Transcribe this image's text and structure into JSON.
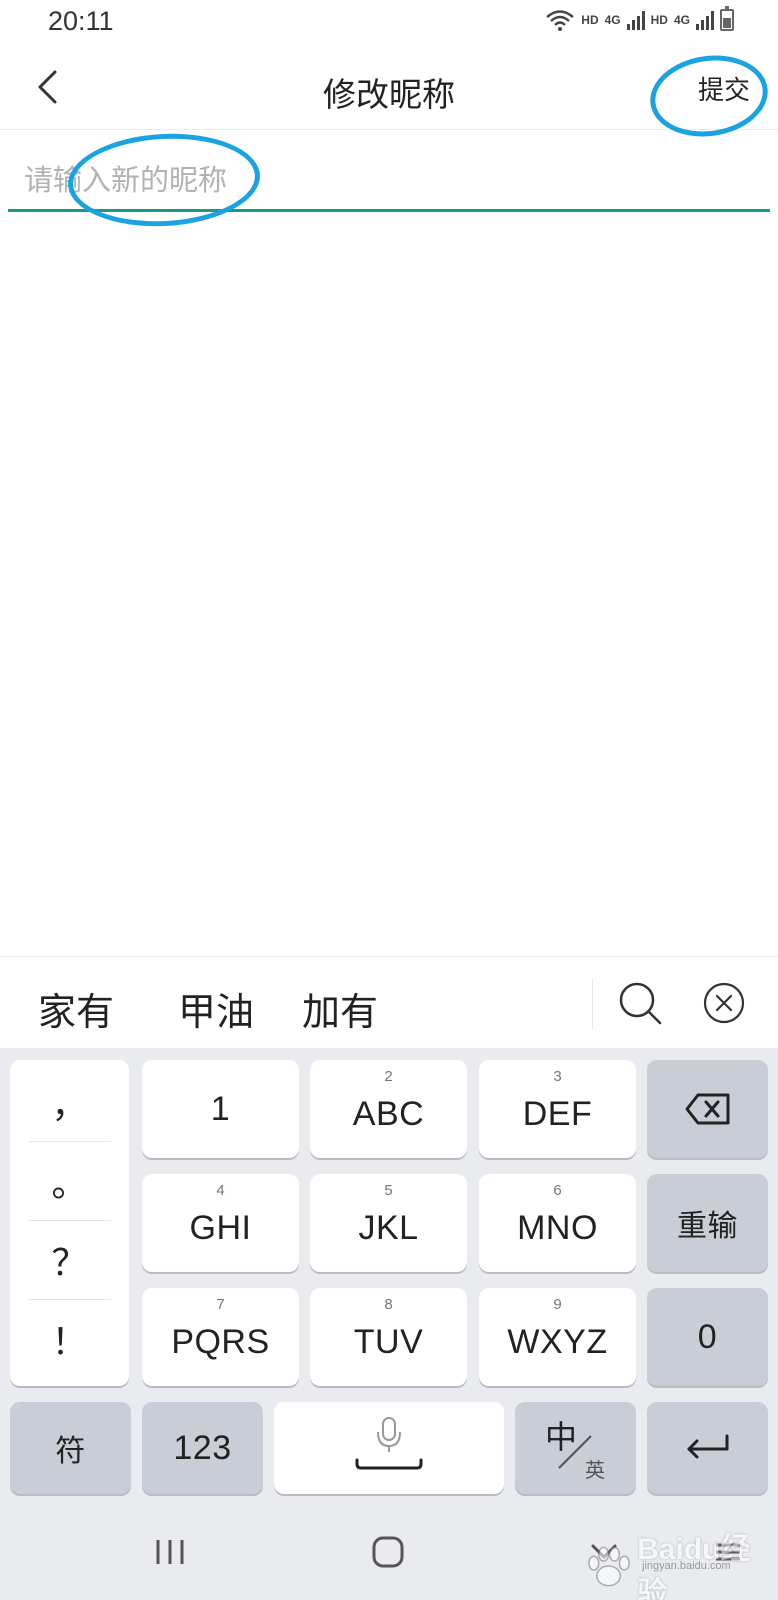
{
  "status_bar": {
    "time": "20:11",
    "hd1": "HD",
    "net1": "4G",
    "hd2": "HD",
    "net2": "4G"
  },
  "nav": {
    "title": "修改昵称",
    "submit_label": "提交"
  },
  "nickname_input": {
    "value": "",
    "placeholder": "请输入新的昵称"
  },
  "candidates": [
    "家有",
    "甲油",
    "加有"
  ],
  "keyboard": {
    "punctuation": [
      "，",
      "。",
      "？",
      "！"
    ],
    "rows": [
      [
        {
          "num": "",
          "label": "1"
        },
        {
          "num": "2",
          "label": "ABC"
        },
        {
          "num": "3",
          "label": "DEF"
        }
      ],
      [
        {
          "num": "4",
          "label": "GHI"
        },
        {
          "num": "5",
          "label": "JKL"
        },
        {
          "num": "6",
          "label": "MNO"
        }
      ],
      [
        {
          "num": "7",
          "label": "PQRS"
        },
        {
          "num": "8",
          "label": "TUV"
        },
        {
          "num": "9",
          "label": "WXYZ"
        }
      ]
    ],
    "reset_label": "重输",
    "zero_label": "0",
    "symbol_label": "符",
    "num_label": "123",
    "lang_primary": "中",
    "lang_secondary": "英"
  },
  "watermark": {
    "brand": "Baidu经验",
    "url": "jingyan.baidu.com"
  },
  "colors": {
    "accent_underline": "#159b86",
    "annotation_circle": "#1aa3e0",
    "keyboard_bg": "#e9ebef",
    "function_key": "#c9ced6"
  }
}
